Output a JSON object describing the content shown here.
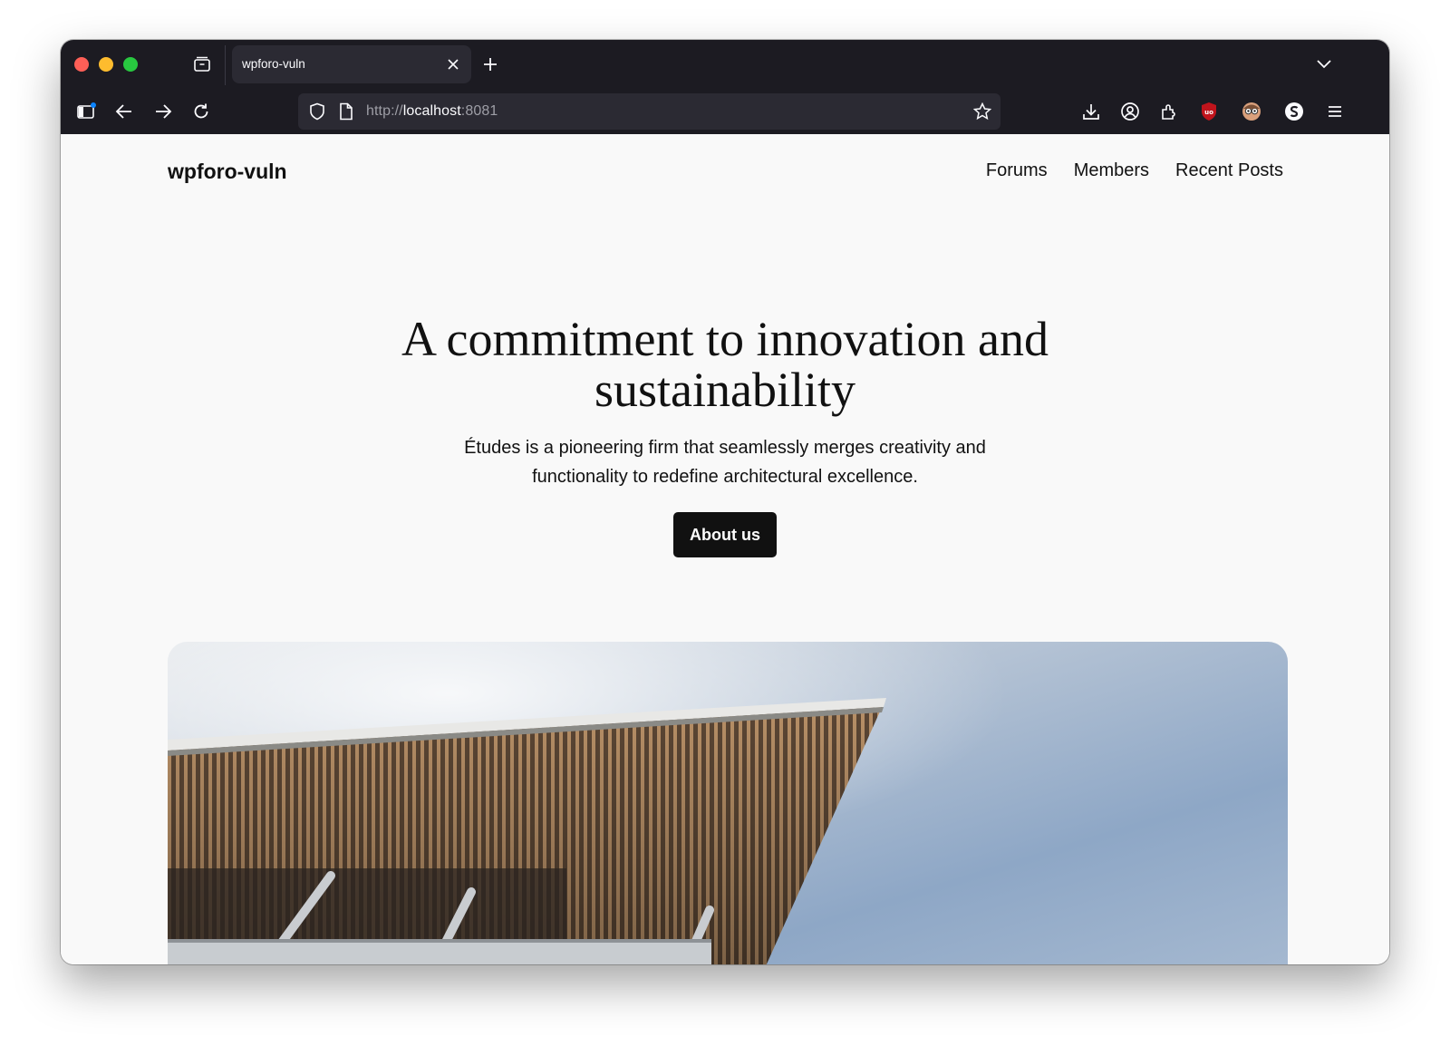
{
  "browser": {
    "tab_title": "wpforo-vuln",
    "url_prefix": "http://",
    "url_host": "localhost",
    "url_port": ":8081",
    "icons": [
      "tab-collections-icon",
      "close-icon",
      "plus-icon",
      "chevron-down-icon",
      "sidebar-icon",
      "back-arrow-icon",
      "forward-arrow-icon",
      "reload-icon",
      "shield-icon",
      "page-icon",
      "star-icon",
      "download-icon",
      "account-icon",
      "extensions-icon",
      "ublock-icon",
      "extension-face-icon",
      "extension-s-icon",
      "menu-icon"
    ]
  },
  "site": {
    "title": "wpforo-vuln",
    "nav": [
      "Forums",
      "Members",
      "Recent Posts"
    ]
  },
  "hero": {
    "heading_line1": "A commitment to innovation and",
    "heading_line2": "sustainability",
    "subtext_line1": "Études is a pioneering firm that seamlessly merges creativity and",
    "subtext_line2": "functionality to redefine architectural excellence.",
    "button_label": "About us"
  },
  "colors": {
    "chrome": "#1c1b22",
    "tab": "#2b2a33",
    "page_bg": "#f9f9f9",
    "text": "#111111",
    "button": "#111111"
  }
}
